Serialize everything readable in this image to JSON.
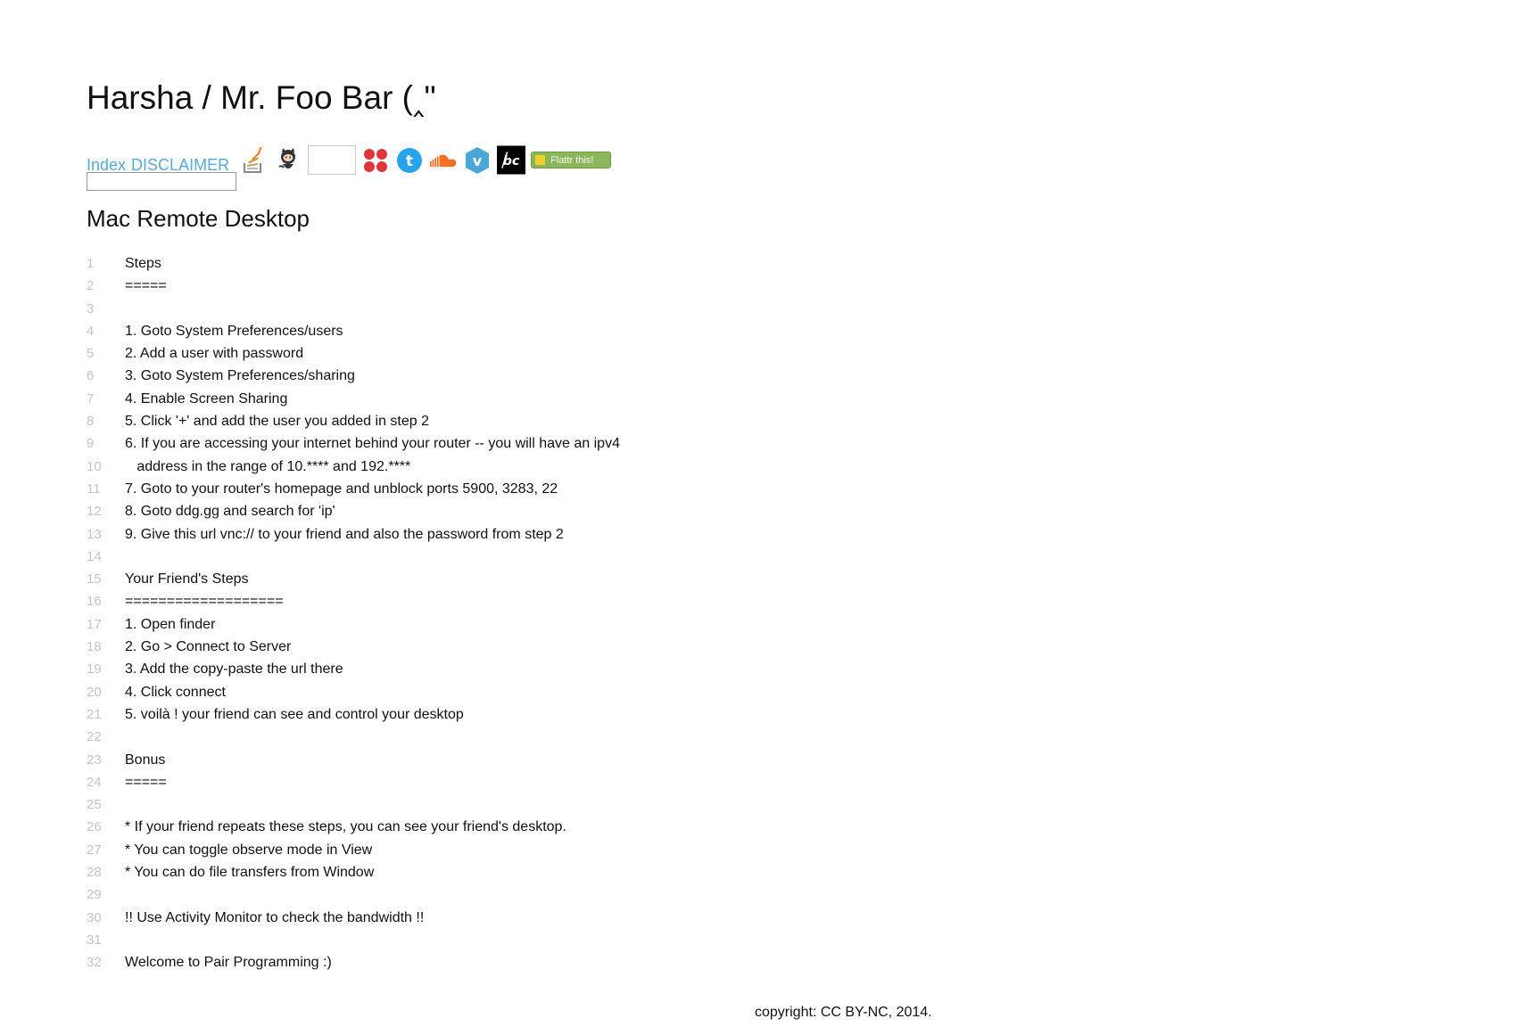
{
  "header": {
    "title": "Harsha / Mr. Foo Bar (‸\""
  },
  "nav": {
    "links": [
      "Index",
      "DISCLAIMER"
    ],
    "icons": [
      "stackoverflow-icon",
      "github-icon",
      "blank-icon",
      "dots-icon",
      "twitter-icon",
      "soundcloud-icon",
      "vimeo-icon",
      "bandcamp-icon"
    ],
    "flattr_label": "Flattr this!",
    "search_value": ""
  },
  "post": {
    "title": "Mac Remote Desktop",
    "lines": [
      "Steps",
      "=====",
      "",
      "1. Goto System Preferences/users",
      "2. Add a user with password",
      "3. Goto System Preferences/sharing",
      "4. Enable Screen Sharing",
      "5. Click '+' and add the user you added in step 2",
      "6. If you are accessing your internet behind your router -- you will have an ipv4",
      "   address in the range of 10.**** and 192.****",
      "7. Goto to your router's homepage and unblock ports 5900, 3283, 22",
      "8. Goto ddg.gg and search for 'ip'",
      "9. Give this url vnc:// to your friend and also the password from step 2",
      "",
      "Your Friend's Steps",
      "===================",
      "1. Open finder",
      "2. Go > Connect to Server",
      "3. Add the copy-paste the url there",
      "4. Click connect",
      "5. voilà ! your friend can see and control your desktop",
      "",
      "Bonus",
      "=====",
      "",
      "* If your friend repeats these steps, you can see your friend's desktop.",
      "* You can toggle observe mode in View",
      "* You can do file transfers from Window",
      "",
      "!! Use Activity Monitor to check the bandwidth !!",
      "",
      "Welcome to Pair Programming :)"
    ]
  },
  "footer": {
    "copyright": "copyright: CC BY-NC, 2014."
  },
  "colors": {
    "link": "#5aa9d6",
    "line_number": "#c4c4c4",
    "text": "#111111",
    "flattr": "#8ab75a"
  }
}
